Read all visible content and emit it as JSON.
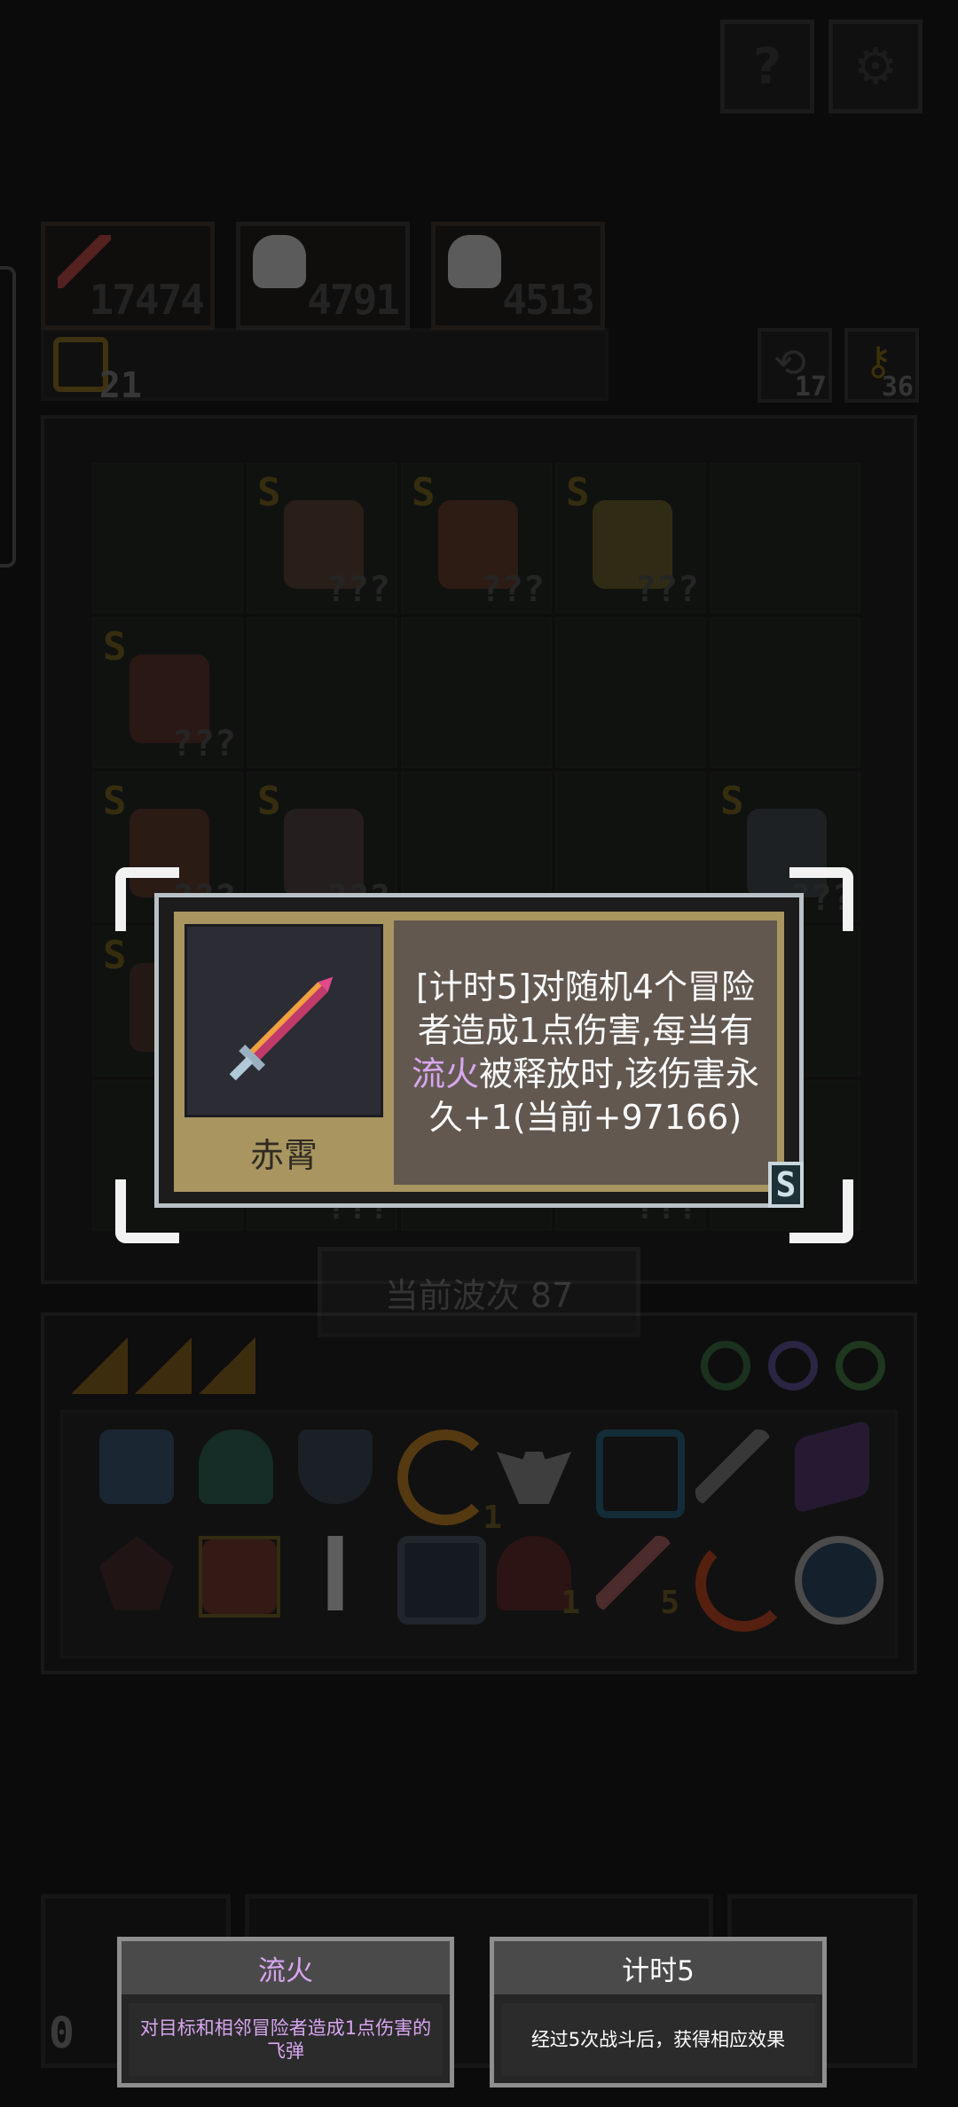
{
  "top_buttons": {
    "help": "?",
    "settings": "⚙"
  },
  "stats": [
    {
      "icon": "sword-icon",
      "value": "17474"
    },
    {
      "icon": "skull-icon",
      "value": "4791"
    },
    {
      "icon": "skull-icon",
      "value": "4513"
    }
  ],
  "coin": {
    "count": "21"
  },
  "resources": [
    {
      "icon": "refresh-icon",
      "value": "17"
    },
    {
      "icon": "key-icon",
      "value": "36"
    }
  ],
  "board": {
    "rows": [
      [
        {
          "s": "",
          "q": ""
        },
        {
          "s": "S",
          "q": "???",
          "c": "#5a3a2a"
        },
        {
          "s": "S",
          "q": "???",
          "c": "#5e3320"
        },
        {
          "s": "S",
          "q": "???",
          "c": "#6a5a20"
        },
        {
          "s": "",
          "q": ""
        }
      ],
      [
        {
          "s": "S",
          "q": "???",
          "c": "#5a2a22"
        },
        {
          "s": "",
          "q": ""
        },
        {
          "s": "",
          "q": ""
        },
        {
          "s": "",
          "q": ""
        },
        {
          "s": "",
          "q": ""
        }
      ],
      [
        {
          "s": "S",
          "q": "???",
          "c": "#5a3020"
        },
        {
          "s": "S",
          "q": "???",
          "c": "#4a3a3a"
        },
        {
          "s": "",
          "q": ""
        },
        {
          "s": "",
          "q": ""
        },
        {
          "s": "S",
          "q": "???",
          "c": "#3a4048"
        }
      ],
      [
        {
          "s": "S",
          "q": "",
          "c": "#4a2a22"
        },
        {
          "s": "",
          "q": ""
        },
        {
          "s": "",
          "q": ""
        },
        {
          "s": "",
          "q": ""
        },
        {
          "s": "",
          "q": ""
        }
      ],
      [
        {
          "s": "",
          "q": ""
        },
        {
          "s": "",
          "q": "???"
        },
        {
          "s": "",
          "q": ""
        },
        {
          "s": "",
          "q": "???"
        },
        {
          "s": "",
          "q": ""
        }
      ]
    ]
  },
  "wave": {
    "label": "当前波次 87"
  },
  "tooltip": {
    "item_name": "赤霄",
    "desc_part1": "[计时5]对随机4个冒险者造成1点伤害,每当有",
    "desc_highlight": "流火",
    "desc_part2": "被释放时,该伤害永久+1(当前+97166)",
    "rarity": "S"
  },
  "bottom_cards": [
    {
      "title": "流火",
      "body": "对目标和相邻冒险者造成1点伤害的飞弹",
      "title_color": "#d8a6f0",
      "body_color": "#d8a6f0"
    },
    {
      "title": "计时5",
      "body": "经过5次战斗后，获得相应效果",
      "title_color": "#ffffff",
      "body_color": "#ffffff"
    }
  ],
  "bottom_left_count": "0",
  "colors": {
    "tooltip_frame": "#a89560",
    "tooltip_desc_bg": "#625850",
    "highlight": "#d8a6f0"
  }
}
